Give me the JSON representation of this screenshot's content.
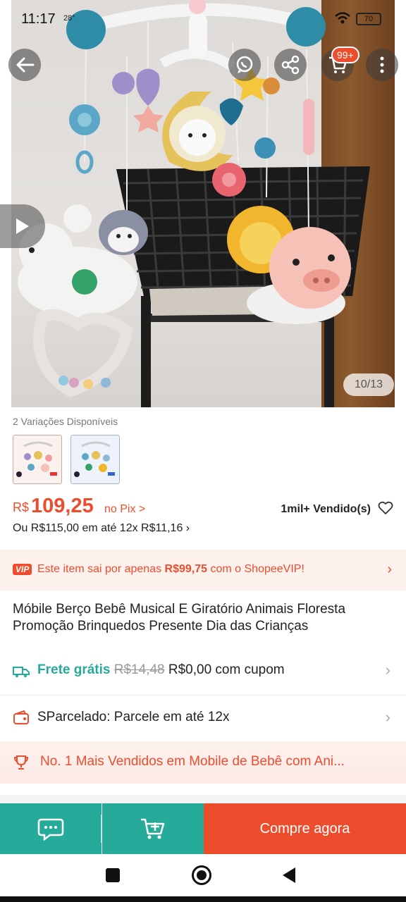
{
  "status_bar": {
    "time": "11:17",
    "temp": "28°",
    "battery": "70"
  },
  "header": {
    "cart_badge": "99+"
  },
  "gallery": {
    "counter": "10/13"
  },
  "variations": {
    "label": "2 Variações Disponíveis"
  },
  "price": {
    "currency": "R$",
    "value": "109,25",
    "pix_label": "no Pix >",
    "sold": "1mil+ Vendido(s)",
    "installments": "Ou R$115,00 em até 12x R$11,16 ›"
  },
  "vip_banner": {
    "logo": "VIP",
    "text_before": "Este item sai por apenas ",
    "text_price": "R$99,75",
    "text_after": " com o ShopeeVIP!"
  },
  "product": {
    "title": "Móbile Berço Bebê Musical E Giratório Animais Floresta Promoção Brinquedos Presente Dia das Crianças"
  },
  "shipping": {
    "label": "Frete grátis",
    "old_price": "R$14,48",
    "new_price": "R$0,00 com cupom"
  },
  "installment_row": {
    "text": "SParcelado: Parcele em até 12x"
  },
  "bestseller": {
    "text": "No. 1 Mais Vendidos em Mobile de Bebê com Ani..."
  },
  "bottom_bar": {
    "buy_label": "Compre agora"
  },
  "colors": {
    "brand": "#ee4d2d",
    "teal": "#26aa99"
  }
}
